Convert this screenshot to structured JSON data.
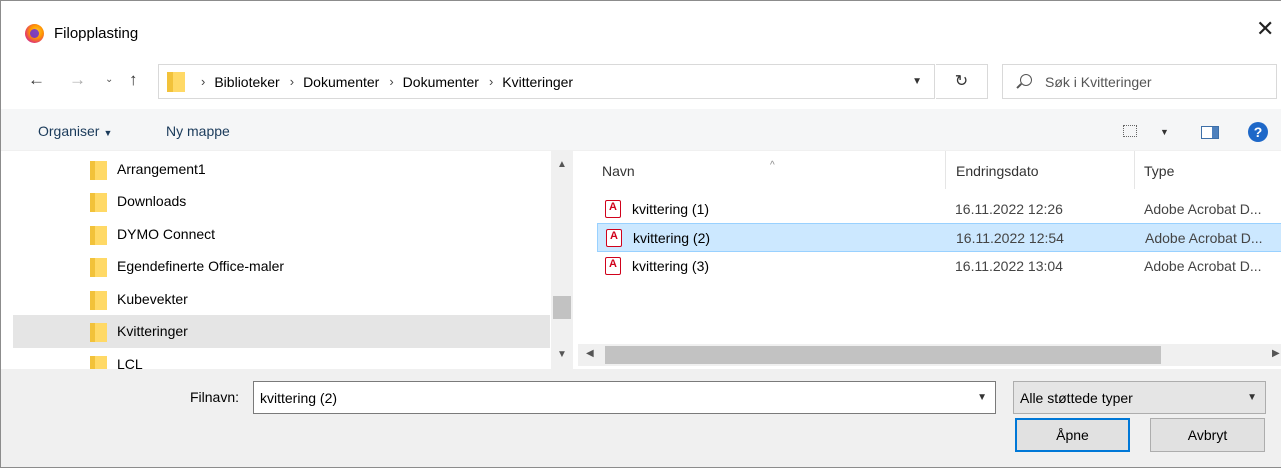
{
  "window": {
    "title": "Filopplasting",
    "close_glyph": "✕"
  },
  "nav": {
    "back": "←",
    "forward": "→",
    "recent": "⌄",
    "up": "↑",
    "breadcrumbs": [
      "Biblioteker",
      "Dokumenter",
      "Dokumenter",
      "Kvitteringer"
    ],
    "refresh": "↻",
    "search_placeholder": "Søk i Kvitteringer"
  },
  "toolbar": {
    "organise": "Organiser",
    "new_folder": "Ny mappe",
    "help": "?"
  },
  "tree": {
    "items": [
      {
        "label": "Arrangement1",
        "selected": false
      },
      {
        "label": "Downloads",
        "selected": false
      },
      {
        "label": "DYMO Connect",
        "selected": false
      },
      {
        "label": "Egendefinerte Office-maler",
        "selected": false
      },
      {
        "label": "Kubevekter",
        "selected": false
      },
      {
        "label": "Kvitteringer",
        "selected": true
      },
      {
        "label": "LCL",
        "selected": false
      }
    ]
  },
  "list": {
    "columns": {
      "name": "Navn",
      "date": "Endringsdato",
      "type": "Type"
    },
    "rows": [
      {
        "name": "kvittering (1)",
        "date": "16.11.2022 12:26",
        "type": "Adobe Acrobat D...",
        "selected": false
      },
      {
        "name": "kvittering (2)",
        "date": "16.11.2022 12:54",
        "type": "Adobe Acrobat D...",
        "selected": true
      },
      {
        "name": "kvittering (3)",
        "date": "16.11.2022 13:04",
        "type": "Adobe Acrobat D...",
        "selected": false
      }
    ]
  },
  "bottom": {
    "filename_label": "Filnavn:",
    "filename_value": "kvittering (2)",
    "filetype_value": "Alle støttede typer",
    "open_label": "Åpne",
    "cancel_label": "Avbryt"
  },
  "colors": {
    "selection": "#cce8ff",
    "selection_border": "#99d1ff",
    "accent": "#0078d7",
    "pdf_red": "#d0021b",
    "folder": "#ffd966"
  }
}
